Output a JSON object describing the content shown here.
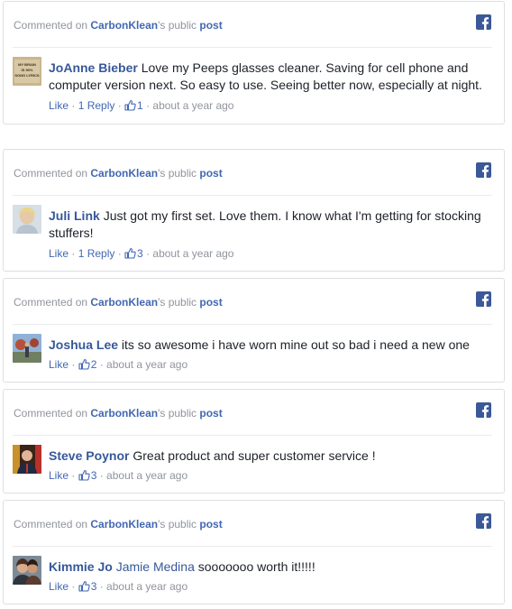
{
  "header": {
    "prefix": "Commented on ",
    "page_name": "CarbonKlean",
    "suffix": "'s public ",
    "post_link": "post"
  },
  "icons": {
    "facebook": "facebook-icon",
    "like_thumb": "thumbs-up-icon"
  },
  "colors": {
    "link": "#4267b2",
    "author": "#365899",
    "muted": "#90949c",
    "facebook_blue": "#3b5998"
  },
  "actions": {
    "like": "Like",
    "separator": " · ",
    "reply": "1 Reply"
  },
  "comments": [
    {
      "author": "JoAnne Bieber",
      "text": "Love my Peeps glasses cleaner. Saving for cell phone and computer version next. So easy to use. Seeing better now, especially at night.",
      "likes": "1",
      "time": "about a year ago",
      "avatar_text": "MY BRAIN IS 90% SONG LYRICS"
    },
    {
      "author": "Juli Link",
      "text": "Just got my first set. Love them. I know what I'm getting for stocking stuffers!",
      "likes": "3",
      "time": "about a year ago"
    },
    {
      "author": "Joshua Lee",
      "text": "its so awesome i have worn mine out so bad i need a new one",
      "likes": "2",
      "time": "about a year ago"
    },
    {
      "author": "Steve Poynor",
      "text": "Great product and super customer service !",
      "likes": "3",
      "time": "about a year ago"
    },
    {
      "author": "Kimmie Jo",
      "mention": "Jamie Medina",
      "text": "sooooooo worth it!!!!!",
      "likes": "3",
      "time": "about a year ago"
    }
  ]
}
